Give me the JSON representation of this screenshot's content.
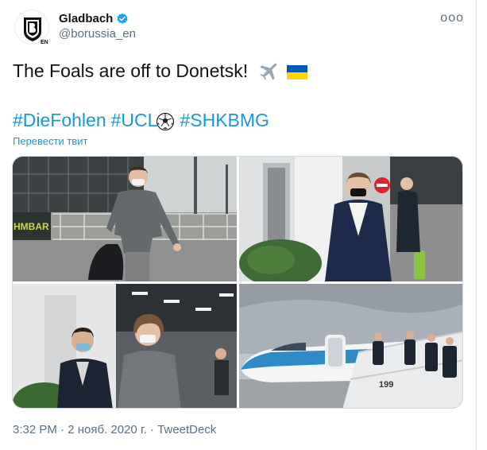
{
  "account": {
    "display_name": "Gladbach",
    "handle": "@borussia_en",
    "verified": true,
    "avatar_icon": "borussia-crest-icon",
    "avatar_subtext": "EN"
  },
  "more_label": "ooo",
  "tweet": {
    "text": "The Foals are off to Donetsk!",
    "emoji": [
      "airplane-icon",
      "ukraine-flag-icon"
    ],
    "hashtags": [
      "#DieFohlen",
      "#UCL",
      "#SHKBMG"
    ],
    "translate_label": "Перевести твит"
  },
  "photos": [
    {
      "name": "player-walking-grey-sweater",
      "sign_text": "HMBAR"
    },
    {
      "name": "player-navy-jacket-terminal"
    },
    {
      "name": "players-corridor"
    },
    {
      "name": "team-boarding-plane",
      "tail_number": "199"
    }
  ],
  "meta": {
    "time": "3:32 PM",
    "separator": "·",
    "date": "2 нояб. 2020 г.",
    "source": "TweetDeck"
  },
  "colors": {
    "link": "#1b95e0",
    "secondary": "#5b7083",
    "verified": "#1da1f2"
  }
}
